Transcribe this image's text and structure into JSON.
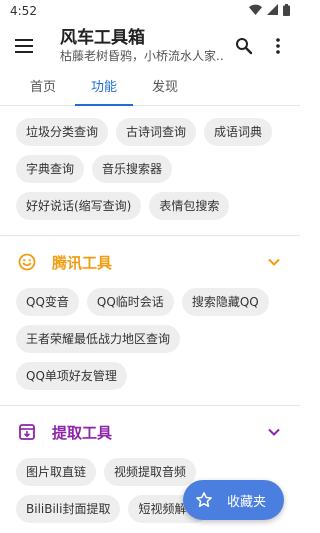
{
  "status": {
    "time": "4:52"
  },
  "appbar": {
    "title": "风车工具箱",
    "subtitle": "枯藤老树昏鸦，小桥流水人家..."
  },
  "tabs": [
    {
      "label": "首页"
    },
    {
      "label": "功能"
    },
    {
      "label": "发现"
    }
  ],
  "top_chips": [
    {
      "label": "垃圾分类查询"
    },
    {
      "label": "古诗词查询"
    },
    {
      "label": "成语词典"
    },
    {
      "label": "字典查询"
    },
    {
      "label": "音乐搜索器"
    },
    {
      "label": "好好说话(缩写查询)"
    },
    {
      "label": "表情包搜索"
    }
  ],
  "sections": [
    {
      "title": "腾讯工具",
      "color": "#f39c12",
      "icon": "smiley-icon",
      "chips": [
        {
          "label": "QQ变音"
        },
        {
          "label": "QQ临时会话"
        },
        {
          "label": "搜索隐藏QQ"
        },
        {
          "label": "王者荣耀最低战力地区查询"
        },
        {
          "label": "QQ单项好友管理"
        }
      ]
    },
    {
      "title": "提取工具",
      "color": "#8e24aa",
      "icon": "download-box-icon",
      "chips": [
        {
          "label": "图片取直链"
        },
        {
          "label": "视频提取音频"
        },
        {
          "label": "BiliBili封面提取"
        },
        {
          "label": "短视频解析"
        }
      ]
    }
  ],
  "fab": {
    "label": "收藏夹",
    "icon": "star-icon"
  }
}
